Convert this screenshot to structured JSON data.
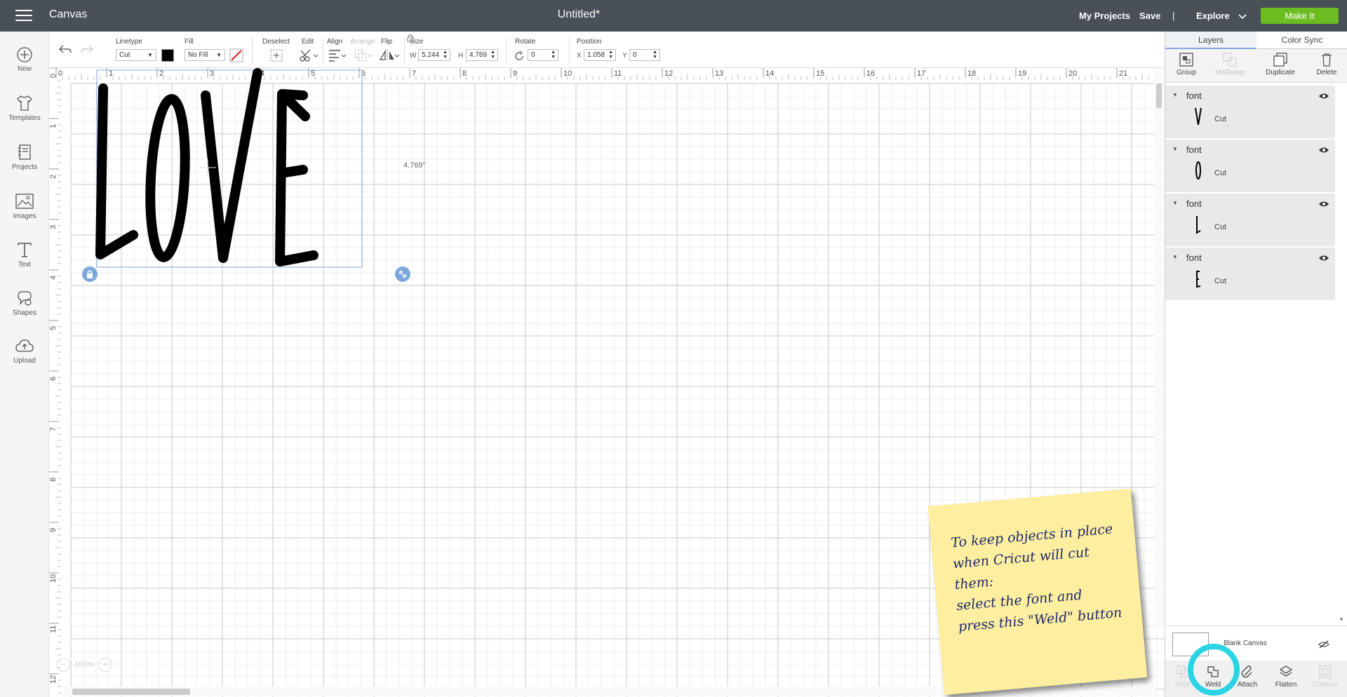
{
  "header": {
    "app_title": "Canvas",
    "doc_title": "Untitled*",
    "my_projects": "My Projects",
    "save": "Save",
    "separator": "|",
    "machine": "Explore",
    "make_it": "Make It"
  },
  "sidebar": {
    "items": [
      {
        "label": "New",
        "icon": "plus-circle-icon"
      },
      {
        "label": "Templates",
        "icon": "tshirt-icon"
      },
      {
        "label": "Projects",
        "icon": "projects-icon"
      },
      {
        "label": "Images",
        "icon": "image-icon"
      },
      {
        "label": "Text",
        "icon": "text-icon"
      },
      {
        "label": "Shapes",
        "icon": "shapes-icon"
      },
      {
        "label": "Upload",
        "icon": "upload-cloud-icon"
      }
    ]
  },
  "toolbar": {
    "linetype_label": "Linetype",
    "linetype_value": "Cut",
    "fill_label": "Fill",
    "fill_value": "No Fill",
    "deselect_label": "Deselect",
    "edit_label": "Edit",
    "align_label": "Align",
    "arrange_label": "Arrange",
    "flip_label": "Flip",
    "size_label": "Size",
    "w_label": "W",
    "w_value": "5.244",
    "h_label": "H",
    "h_value": "4.769",
    "rotate_label": "Rotate",
    "rotate_value": "0",
    "position_label": "Position",
    "x_label": "X",
    "x_value": "1.058",
    "y_label": "Y",
    "y_value": "0",
    "color_swatch": "#000000"
  },
  "canvas": {
    "ruler_h": [
      "0",
      "1",
      "2",
      "3",
      "4",
      "5",
      "6",
      "7",
      "8",
      "9",
      "10",
      "11",
      "12",
      "13",
      "14",
      "15",
      "16",
      "17",
      "18",
      "19",
      "20",
      "21"
    ],
    "ruler_v": [
      "0",
      "1",
      "2",
      "3",
      "4",
      "5",
      "6",
      "7",
      "8",
      "9",
      "10",
      "11",
      "12"
    ],
    "design_text": "LOVE",
    "height_readout": "4.769\"",
    "zoom": "100%"
  },
  "panel": {
    "tab_layers": "Layers",
    "tab_color_sync": "Color Sync",
    "group": "Group",
    "ungroup": "UnGroup",
    "duplicate": "Duplicate",
    "delete": "Delete",
    "layers": [
      {
        "name": "font",
        "type": "Cut"
      },
      {
        "name": "font",
        "type": "Cut"
      },
      {
        "name": "font",
        "type": "Cut"
      },
      {
        "name": "font",
        "type": "Cut"
      }
    ],
    "blank_canvas": "Blank Canvas",
    "slice": "Slice",
    "weld": "Weld",
    "attach": "Attach",
    "flatten": "Flatten",
    "contour": "Contour",
    "highlight_color": "#2ad4e4"
  },
  "note": {
    "line1": "To keep objects in place",
    "line2": "when Cricut will cut them:",
    "line3": "select the font and",
    "line4": "press this \"Weld\" button"
  }
}
